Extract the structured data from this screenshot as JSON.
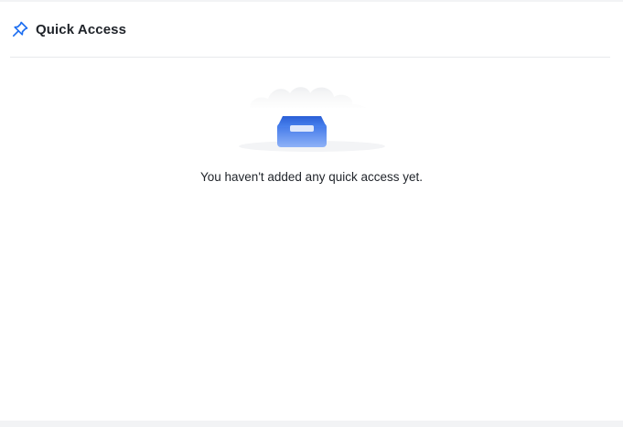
{
  "header": {
    "title": "Quick Access",
    "icon": "pin-icon",
    "accent": "#1e6ff1"
  },
  "empty_state": {
    "illustration": "empty-inbox-illustration",
    "message": "You haven't added any quick access yet."
  }
}
